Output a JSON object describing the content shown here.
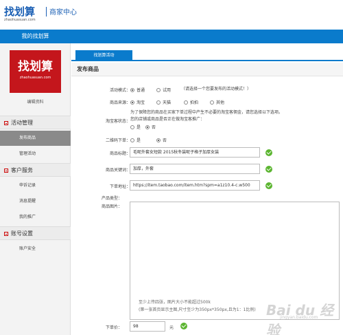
{
  "header": {
    "logo": "找划算",
    "subtitle": "商家中心",
    "url": "zhaohuasuan.com"
  },
  "bluebar": {
    "title": "我的找划算"
  },
  "sidebar": {
    "promo_text": "找划算",
    "promo_url": "zhaohuasuan.com",
    "edit_label": "编辑资料",
    "groups": [
      {
        "title": "活动管理",
        "items": [
          "发布商品",
          "管理活动"
        ]
      },
      {
        "title": "客户服务",
        "items": [
          "申诉记录",
          "消息提醒",
          "我的推广"
        ]
      },
      {
        "title": "账号设置",
        "items": [
          "账户安全"
        ]
      }
    ],
    "active_item": "发布商品"
  },
  "main": {
    "tab": "找划算活动",
    "section_title": "发布商品",
    "activity_mode": {
      "label": "活动模式：",
      "options": [
        "普通",
        "试用"
      ],
      "selected": "普通",
      "hint": "（请选择一个您要发布的活动模式！）"
    },
    "product_source": {
      "label": "商品来源：",
      "options": [
        "淘宝",
        "天猫",
        "拍拍",
        "其他"
      ],
      "selected": "淘宝"
    },
    "taobao_agent": {
      "label": "淘宝客状态：",
      "note1": "为了保障您的商品在买家下单过程中产生不必要的淘宝客佣金，请您选择以下选项。",
      "note2": "您的店铺或商品是否正在做淘宝客推广：",
      "options": [
        "是",
        "否"
      ],
      "selected": "否"
    },
    "qr_order": {
      "label": "二维码下单：",
      "options": [
        "是",
        "否"
      ],
      "selected": "否"
    },
    "product_title": {
      "label": "商品标题：",
      "value": "毛呢外套女短款 2015秋冬装呢子格子加厚女装"
    },
    "keywords": {
      "label": "商品关键词：",
      "value": "加厚，外套"
    },
    "order_url": {
      "label": "下单地址：",
      "value": "https://item.taobao.com/item.htm?spm=a1z10.4-c.w500"
    },
    "product_type": {
      "label": "产品类型："
    },
    "product_images": {
      "label": "商品图片：",
      "hint1": "至少上传四张，图片大小不能超过500k",
      "hint2": "(第一张首页显示主图,尺寸至少为350px*350px,且为1：1比例)"
    },
    "price": {
      "label": "下单价：",
      "value": "98",
      "unit": "元"
    }
  },
  "watermark": {
    "text": "Bai du 经验",
    "url": "jingyan.baidu.com"
  },
  "colors": {
    "brand_blue": "#0a7bcc",
    "promo_red": "#c4161c",
    "ok_green": "#5cb531"
  }
}
